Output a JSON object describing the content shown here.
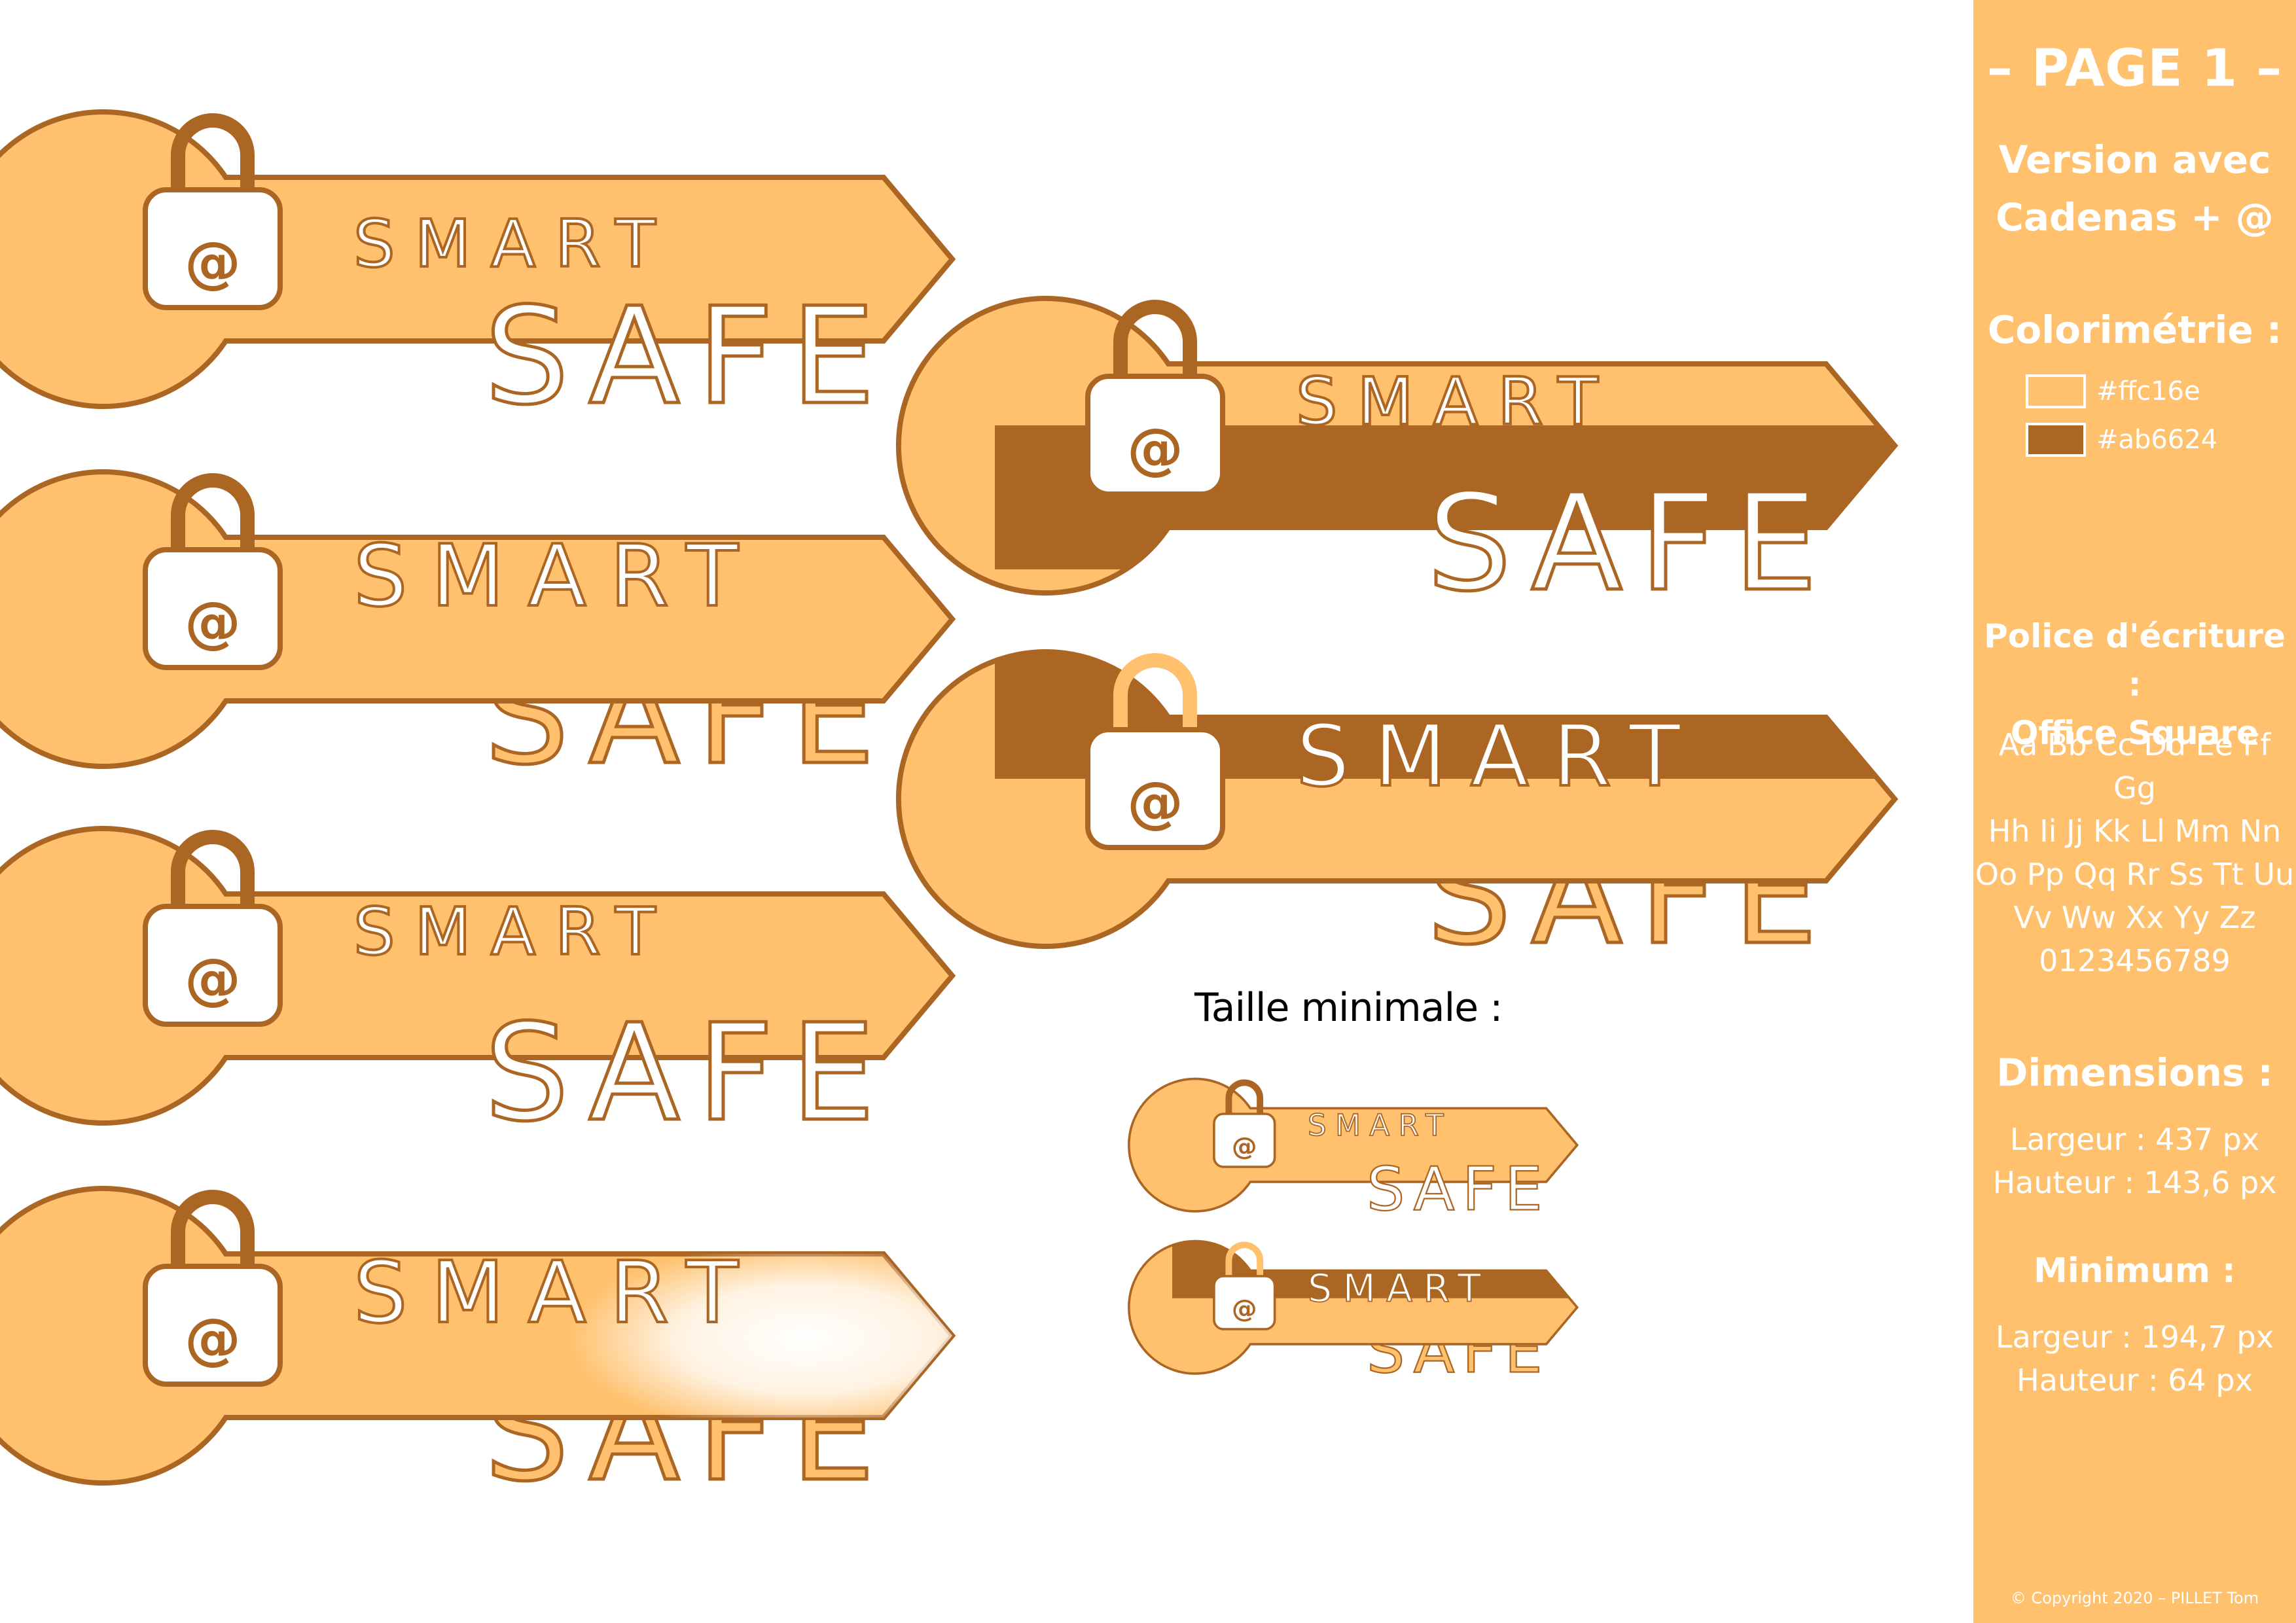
{
  "colors": {
    "light": "#ffc16e",
    "dark": "#ab6624",
    "white": "#ffffff"
  },
  "logo": {
    "line1": "SMART",
    "line2": "SAFE",
    "symbol": "@",
    "icon": "padlock-at-icon"
  },
  "minimum_caption": "Taille minimale :",
  "panel": {
    "page": "– PAGE 1 –",
    "version_line1": "Version avec",
    "version_line2": "Cadenas + @",
    "colorimetry_title": "Colorimétrie :",
    "color1_hex": "#ffc16e",
    "color2_hex": "#ab6624",
    "font_title": "Police d'écriture :",
    "font_name": "Office Square",
    "alphabet": [
      "Aa Bb Cc Dd Ee Ff Gg",
      "Hh Ii Jj Kk Ll Mm Nn",
      "Oo Pp Qq Rr Ss Tt Uu",
      "Vv Ww Xx Yy Zz",
      "0123456789"
    ],
    "dimensions_title": "Dimensions :",
    "width": "Largeur : 437 px",
    "height": "Hauteur : 143,6 px",
    "minimum_title": "Minimum :",
    "min_width": "Largeur : 194,7 px",
    "min_height": "Hauteur : 64 px",
    "copyright": "© Copyright 2020 – PILLET Tom"
  }
}
